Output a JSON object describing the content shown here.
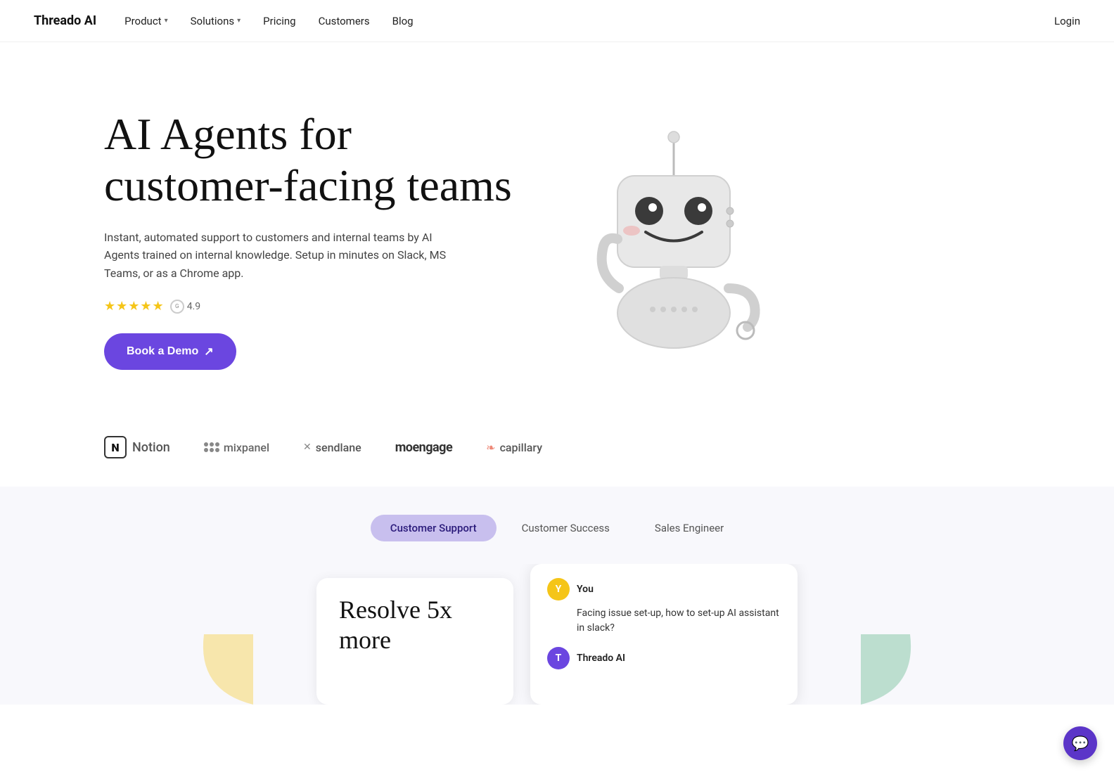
{
  "navbar": {
    "logo": "Threado AI",
    "links": [
      {
        "label": "Product",
        "hasDropdown": true
      },
      {
        "label": "Solutions",
        "hasDropdown": true
      },
      {
        "label": "Pricing",
        "hasDropdown": false
      },
      {
        "label": "Customers",
        "hasDropdown": false
      },
      {
        "label": "Blog",
        "hasDropdown": false
      }
    ],
    "login": "Login"
  },
  "hero": {
    "title_line1": "AI Agents for",
    "title_line2": "customer-facing teams",
    "subtitle": "Instant, automated support to customers and internal teams by AI Agents trained on internal knowledge. Setup in minutes on Slack, MS Teams, or as a Chrome app.",
    "rating_value": "4.9",
    "stars": "★★★★★",
    "cta_label": "Book a Demo",
    "cta_arrow": "↗"
  },
  "logos": [
    {
      "name": "Notion",
      "type": "notion"
    },
    {
      "name": "mixpanel",
      "type": "mixpanel"
    },
    {
      "name": "sendlane",
      "type": "sendlane"
    },
    {
      "name": "moengage",
      "type": "moengage"
    },
    {
      "name": "capillary",
      "type": "capillary"
    }
  ],
  "tabs": {
    "items": [
      {
        "label": "Customer Support",
        "active": true
      },
      {
        "label": "Customer Success",
        "active": false
      },
      {
        "label": "Sales Engineer",
        "active": false
      }
    ]
  },
  "resolve_card": {
    "title": "Resolve 5x more"
  },
  "chat_preview": {
    "user_name": "You",
    "user_message": "Facing issue set-up, how to set-up AI assistant in slack?",
    "bot_name": "Threado AI"
  }
}
